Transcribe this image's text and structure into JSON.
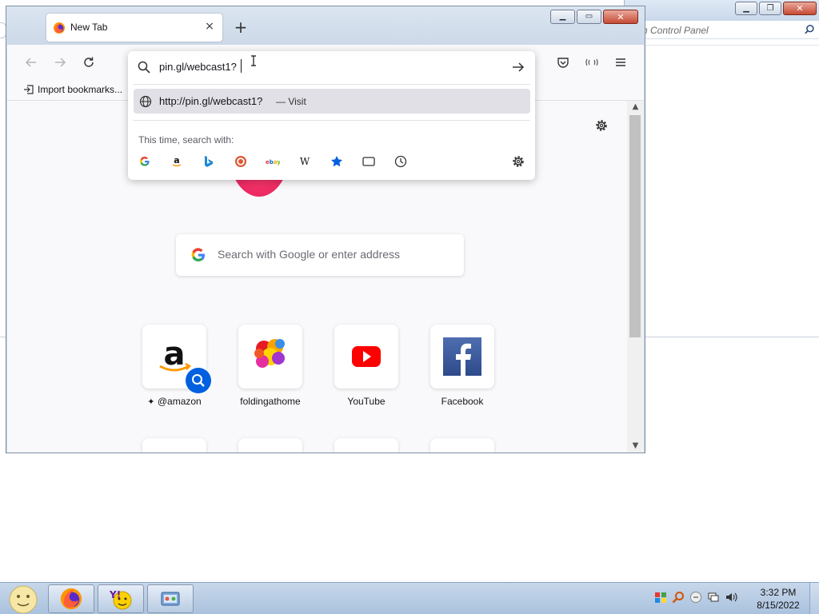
{
  "background_window": {
    "search_placeholder": "Search Control Panel",
    "search_visible": "rch Control Panel"
  },
  "browser": {
    "tab_title": "New Tab",
    "new_tab_glyph": "+",
    "tab_close_glyph": "×",
    "bookmarks_import_label": "Import bookmarks...",
    "urlbar": {
      "value": "pin.gl/webcast1?",
      "result_url": "http://pin.gl/webcast1?",
      "result_action": "— Visit",
      "search_with_label": "This time, search with:",
      "engines": [
        "google-icon",
        "amazon-icon",
        "bing-icon",
        "duckduckgo-icon",
        "ebay-icon",
        "wikipedia-icon",
        "bookmarks-icon",
        "tabs-icon",
        "history-icon"
      ]
    },
    "search_placeholder": "Search with Google or enter address",
    "tiles": [
      {
        "label": "@amazon",
        "icon": "amazon-icon"
      },
      {
        "label": "foldingathome",
        "icon": "foldingathome-icon"
      },
      {
        "label": "YouTube",
        "icon": "youtube-icon"
      },
      {
        "label": "Facebook",
        "icon": "facebook-icon"
      }
    ]
  },
  "taskbar": {
    "time": "3:32 PM",
    "date": "8/15/2022",
    "apps": [
      "firefox-icon",
      "yahoo-messenger-icon",
      "control-panel-icon"
    ]
  },
  "colors": {
    "accent_blue": "#0060df",
    "firefox_pink": "#e01d5d",
    "youtube_red": "#ff0000",
    "facebook_blue": "#3b5998"
  }
}
